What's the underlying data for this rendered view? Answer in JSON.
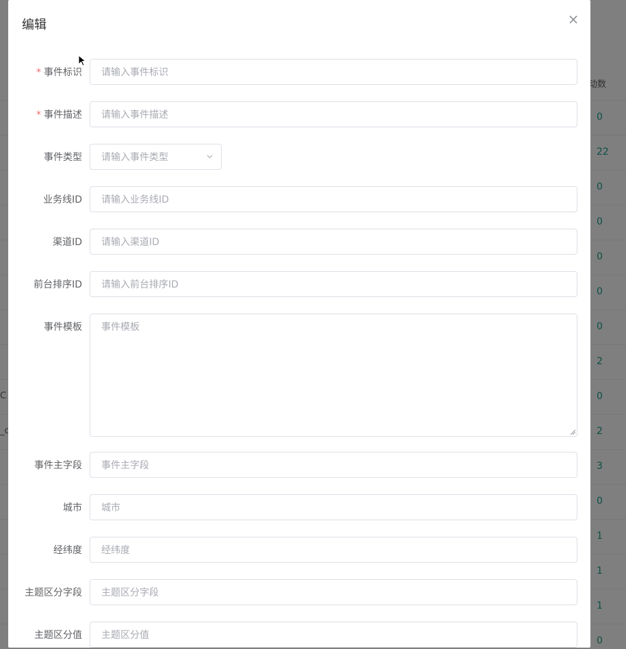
{
  "background": {
    "column_header": "动数",
    "row_values": [
      "0",
      "22",
      "0",
      "0",
      "0",
      "0",
      "0",
      "2",
      "0",
      "2",
      "3",
      "0",
      "1",
      "1",
      "1",
      "0"
    ],
    "left_fragments": [
      "C",
      "_o"
    ]
  },
  "dialog": {
    "title": "编辑",
    "close_label": "×",
    "fields": [
      {
        "label": "事件标识",
        "required": true,
        "placeholder": "请输入事件标识",
        "type": "input"
      },
      {
        "label": "事件描述",
        "required": true,
        "placeholder": "请输入事件描述",
        "type": "input"
      },
      {
        "label": "事件类型",
        "required": false,
        "placeholder": "请输入事件类型",
        "type": "select"
      },
      {
        "label": "业务线ID",
        "required": false,
        "placeholder": "请输入业务线ID",
        "type": "input"
      },
      {
        "label": "渠道ID",
        "required": false,
        "placeholder": "请输入渠道ID",
        "type": "input"
      },
      {
        "label": "前台排序ID",
        "required": false,
        "placeholder": "请输入前台排序ID",
        "type": "input"
      },
      {
        "label": "事件模板",
        "required": false,
        "placeholder": "事件模板",
        "type": "textarea"
      },
      {
        "label": "事件主字段",
        "required": false,
        "placeholder": "事件主字段",
        "type": "input"
      },
      {
        "label": "城市",
        "required": false,
        "placeholder": "城市",
        "type": "input"
      },
      {
        "label": "经纬度",
        "required": false,
        "placeholder": "经纬度",
        "type": "input"
      },
      {
        "label": "主题区分字段",
        "required": false,
        "placeholder": "主题区分字段",
        "type": "input"
      },
      {
        "label": "主题区分值",
        "required": false,
        "placeholder": "主题区分值",
        "type": "input"
      }
    ]
  },
  "colors": {
    "required_star": "#f56c6c",
    "value_teal": "#1a9e8a"
  }
}
